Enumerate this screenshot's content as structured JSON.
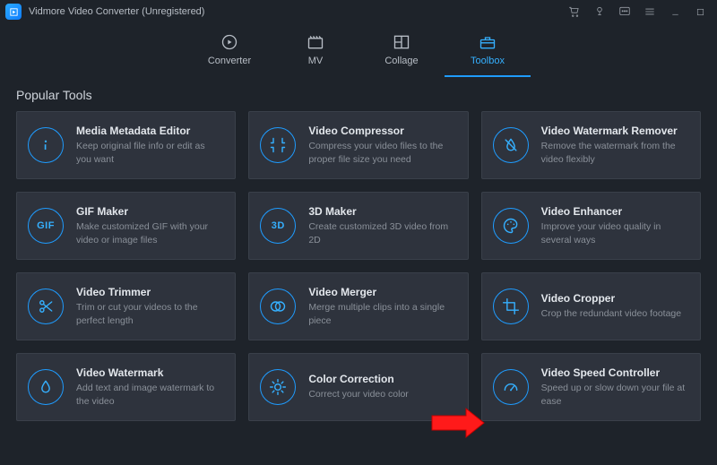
{
  "app": {
    "title": "Vidmore Video Converter (Unregistered)"
  },
  "nav": {
    "items": [
      {
        "label": "Converter"
      },
      {
        "label": "MV"
      },
      {
        "label": "Collage"
      },
      {
        "label": "Toolbox"
      }
    ]
  },
  "section": {
    "title": "Popular Tools"
  },
  "tools": [
    {
      "title": "Media Metadata Editor",
      "desc": "Keep original file info or edit as you want"
    },
    {
      "title": "Video Compressor",
      "desc": "Compress your video files to the proper file size you need"
    },
    {
      "title": "Video Watermark Remover",
      "desc": "Remove the watermark from the video flexibly"
    },
    {
      "title": "GIF Maker",
      "desc": "Make customized GIF with your video or image files"
    },
    {
      "title": "3D Maker",
      "desc": "Create customized 3D video from 2D"
    },
    {
      "title": "Video Enhancer",
      "desc": "Improve your video quality in several ways"
    },
    {
      "title": "Video Trimmer",
      "desc": "Trim or cut your videos to the perfect length"
    },
    {
      "title": "Video Merger",
      "desc": "Merge multiple clips into a single piece"
    },
    {
      "title": "Video Cropper",
      "desc": "Crop the redundant video footage"
    },
    {
      "title": "Video Watermark",
      "desc": "Add text and image watermark to the video"
    },
    {
      "title": "Color Correction",
      "desc": "Correct your video color"
    },
    {
      "title": "Video Speed Controller",
      "desc": "Speed up or slow down your file at ease"
    }
  ],
  "icons": {
    "tool3_text": "GIF",
    "tool4_text": "3D"
  }
}
